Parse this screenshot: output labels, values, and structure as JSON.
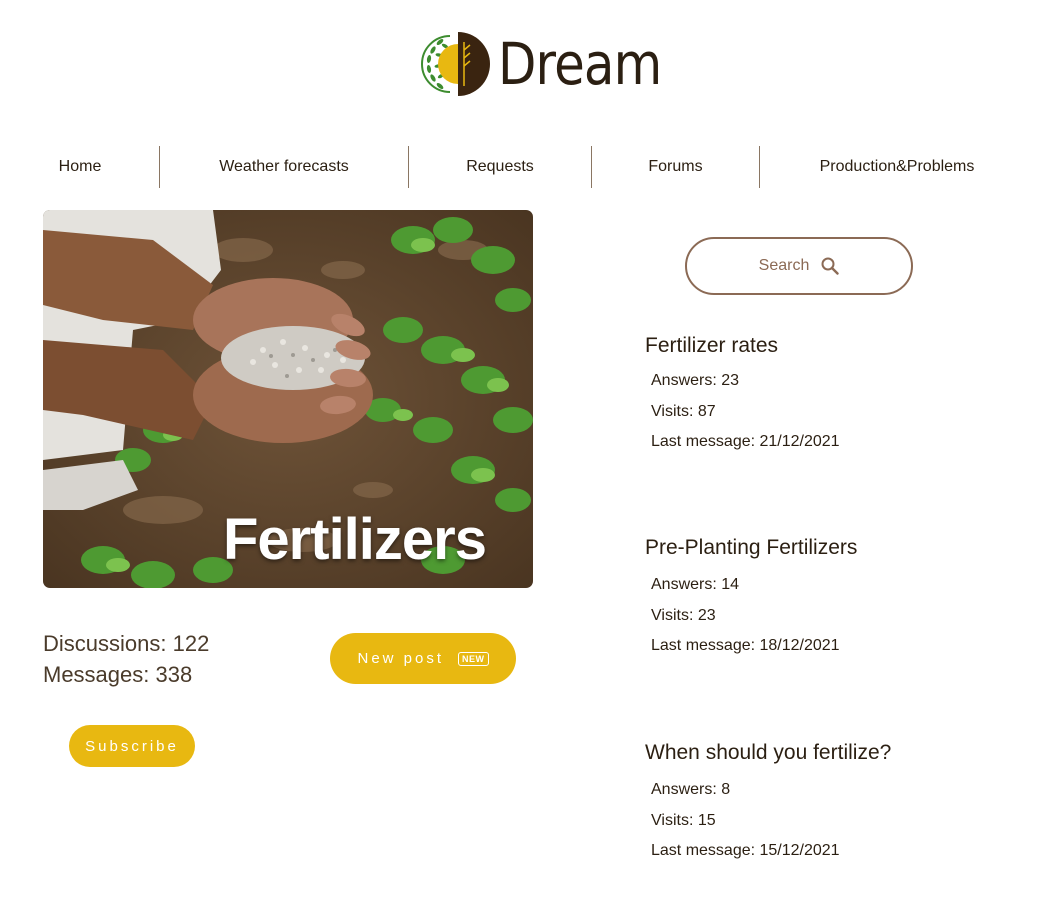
{
  "brand": {
    "name": "Dream"
  },
  "nav": [
    {
      "label": "Home"
    },
    {
      "label": "Weather forecasts"
    },
    {
      "label": "Requests"
    },
    {
      "label": "Forums"
    },
    {
      "label": "Production&Problems"
    }
  ],
  "category": {
    "title": "Fertilizers",
    "discussions": "Discussions: 122",
    "messages": "Messages: 338"
  },
  "actions": {
    "new_post": "New post",
    "new_badge": "NEW",
    "subscribe": "Subscribe"
  },
  "search": {
    "label": "Search"
  },
  "topics": [
    {
      "title": "Fertilizer rates",
      "answers": "Answers: 23",
      "visits": "Visits: 87",
      "last": "Last message: 21/12/2021"
    },
    {
      "title": "Pre-Planting Fertilizers",
      "answers": "Answers: 14",
      "visits": "Visits: 23",
      "last": "Last message: 18/12/2021"
    },
    {
      "title": "When should you fertilize?",
      "answers": "Answers: 8",
      "visits": "Visits: 15",
      "last": "Last message: 15/12/2021"
    }
  ],
  "colors": {
    "accent": "#e8b811",
    "brown": "#3a2410",
    "search_border": "#8b6a55",
    "leaf_green": "#3d8c2f"
  }
}
